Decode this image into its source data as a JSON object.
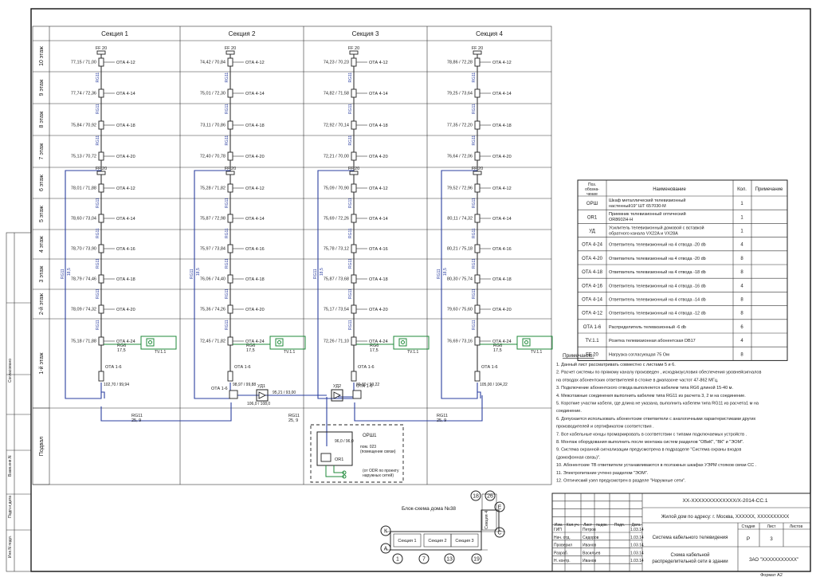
{
  "sections": [
    "Секция 1",
    "Секция 2",
    "Секция 3",
    "Секция 4"
  ],
  "floors": [
    "10 этаж",
    "9 этаж",
    "8 этаж",
    "7 этаж",
    "6 этаж",
    "5 этаж",
    "4 этаж",
    "3 этаж",
    "2-й этаж",
    "1-й этаж"
  ],
  "basement": "Подвал",
  "levels": [
    [
      "77,15 / 71,00",
      "77,74 / 72,36",
      "75,84 / 70,92",
      "75,13 / 70,72",
      "78,01 / 71,88",
      "78,60 / 73,04",
      "78,70 / 73,90",
      "78,79 / 74,46",
      "78,09 / 74,32",
      "75,18 / 71,88"
    ],
    [
      "74,42 / 70,84",
      "75,01 / 72,30",
      "73,11 / 70,86",
      "72,40 / 70,78",
      "75,28 / 71,82",
      "75,87 / 72,98",
      "75,97 / 73,84",
      "76,06 / 74,40",
      "75,36 / 74,26",
      "72,45 / 71,82"
    ],
    [
      "74,23 / 70,23",
      "74,82 / 71,58",
      "72,92 / 70,14",
      "72,21 / 70,00",
      "75,09 / 70,90",
      "75,69 / 72,26",
      "75,78 / 73,12",
      "75,87 / 73,68",
      "75,17 / 73,54",
      "72,26 / 71,10"
    ],
    [
      "78,86 / 72,28",
      "79,25 / 73,64",
      "77,35 / 72,20",
      "76,64 / 72,06",
      "79,52 / 72,96",
      "80,11 / 74,32",
      "80,21 / 75,18",
      "80,30 / 75,74",
      "79,60 / 75,60",
      "76,69 / 73,16"
    ]
  ],
  "taps": [
    "ОТА 4-12",
    "ОТА 4-14",
    "ОТА 4-18",
    "ОТА 4-20",
    "ОТА 4-12",
    "ОТА 4-14",
    "ОТА 4-16",
    "ОТА 4-18",
    "ОТА 4-20",
    "ОТА 4-24"
  ],
  "ff20": "FF 20",
  "rg11": "RG11",
  "rg11_num": "18,5",
  "rg6": "RG6",
  "rg6_num": "17,5",
  "outlet": "TV.1.1",
  "ota16": "ОТА 1-6",
  "basement_levels": [
    "102,70 / 99,94",
    "98,97 / 99,88",
    "89,80 / 99,22",
    "105,00 / 104,22"
  ],
  "ud1": "УД1",
  "ud1_in": "95,21 / 93,00",
  "ud1_out": "106,0 / 108,0",
  "ud2": "УД2",
  "trunk_labels": [
    {
      "a": "RG11",
      "b": "25, 9"
    },
    {
      "a": "RG11",
      "b": "25, 9"
    },
    {
      "a": "RG11",
      "b": "25, 9"
    }
  ],
  "orsh": "ОРШ1",
  "orsh_level": "96,0 / 96,0",
  "orsh_room": [
    "пом. 023",
    "(помещение связи)"
  ],
  "or1": "OR1",
  "odr_note": [
    "(от ODR по проекту",
    "наружных сетей)"
  ],
  "spec": {
    "headers": [
      "Поз. обозна-чение",
      "Наименование",
      "Кол.",
      "Примечание"
    ],
    "rows": [
      {
        "pos": "ОРШ",
        "name": [
          "Шкаф металлический телевизионный",
          "настенный19\" ШТ 657030-М"
        ],
        "qty": "1"
      },
      {
        "pos": "OR1",
        "name": [
          "Приемник телевизионный оптический",
          "OR8602H-H"
        ],
        "qty": "1"
      },
      {
        "pos": "УД",
        "name": [
          "Усилитель телевизионный домовой с вставкой",
          "обратного канала VX22A и VX28A"
        ],
        "qty": "1"
      },
      {
        "pos": "ОТА 4-24",
        "name": [
          "Ответвитель телевизионный на 4 отвода -20 db"
        ],
        "qty": "4"
      },
      {
        "pos": "ОТА 4-20",
        "name": [
          "Ответвитель телевизионный на 4 отвода -20 db"
        ],
        "qty": "8"
      },
      {
        "pos": "ОТА 4-18",
        "name": [
          "Ответвитель телевизионный на 4 отвода -18 db"
        ],
        "qty": "8"
      },
      {
        "pos": "ОТА 4-16",
        "name": [
          "Ответвитель телевизионный на 4 отвода -16 db"
        ],
        "qty": "4"
      },
      {
        "pos": "ОТА 4-14",
        "name": [
          "Ответвитель телевизионный на 4 отвода -14 db"
        ],
        "qty": "8"
      },
      {
        "pos": "ОТА 4-12",
        "name": [
          "Ответвитель телевизионный на 4 отвода -12 db"
        ],
        "qty": "8"
      },
      {
        "pos": "ОТА 1-6",
        "name": [
          "Распределитель телевизионный -6 db"
        ],
        "qty": "6"
      },
      {
        "pos": "TV.1.1",
        "name": [
          "Розетка телевизионная абонентская DB17"
        ],
        "qty": "4"
      },
      {
        "pos": "FF 20",
        "name": [
          "Нагрузка согласующая 75 Ом"
        ],
        "qty": "8"
      }
    ]
  },
  "notes_title": "Примечание:",
  "notes": [
    "1. Данный лист рассматривать совместно с листами    5 и 6.",
    "2. Расчет системы по прямому каналу произведен , исходяизусловия обеспечения уровнейсигналов",
    "  на отводах абонентских ответвителей в стояке в диапазоне частот  47-862 МГц.",
    "3. Подключение абонентского отвода выполняется кабелем типа  RG6 длиной 15-40 м.",
    "4. Межэтажные соединения выполнить кабелем типа  RG11 из расчета 3, 2 м на соединение.",
    "5. Короткие участки кабеля, где длина не указана, выполнить кабелем типа RG11 из расчета1 м на",
    "соединение.",
    "6. Допускается использовать абонентские ответвители с аналогичными характеристиками других",
    "производителей и сертификатом  соответствия .",
    "7. Все кабельные концы промаркировать в соответствии с типами подключаемых устройств .",
    "8. Монтаж оборудования выполнить после монтажа систем разделов  \"ОВиК\", \"ВК\" и \"ЭОМ\".",
    "9. Система охранной сигнализации предусмотрена в подразделе   \"Система охраны входов",
    "  (домофонная связь)\".",
    "10. Абонентские ТВ ответвители устанавливаются в поэтажных шкафах УЭРМ стояков связи СС .",
    "11. Электропитание учтено разделом  \"ЭОМ\".",
    "12. Оптический узел предусмотрен в разделе  \"Наружные сети\"."
  ],
  "block_scheme": {
    "title": "Блок-схема дома №38",
    "sections": [
      "Секция 1",
      "Секция 2",
      "Секция 3",
      "Секция 4"
    ],
    "axes": [
      "К",
      "А",
      "1",
      "7",
      "13",
      "19",
      "18",
      "26",
      "Е",
      "С"
    ]
  },
  "title_block": {
    "code": "XX-XXXXXXXXXXXXX/X-2014-СС.1",
    "address": "Жилой дом по адресу: г. Москва, XXXXXX,  XXXXXXXXXX",
    "system": "Система кабельного телевидения",
    "sheet_name": [
      "Схема кабельной",
      "распределительной сети в здании"
    ],
    "company": "ЗАО \"XXXXXXXXXXX\"",
    "stage_hdr": "Стадия",
    "sheet_hdr": "Лист",
    "sheets_hdr": "Листов",
    "stage": "Р",
    "sheet": "3",
    "cols": [
      "Изм.",
      "Кол.уч.",
      "Лист",
      "№док.",
      "Подп.",
      "Дата"
    ],
    "people": [
      {
        "role": "ГИП",
        "name": "Петров",
        "date": "1.03.14"
      },
      {
        "role": "Нач. отд.",
        "name": "Сидоров",
        "date": "1.03.14"
      },
      {
        "role": "Проверил",
        "name": "Иванов",
        "date": "1.03.14"
      },
      {
        "role": "Разраб.",
        "name": "Васильев",
        "date": "1.03.14"
      },
      {
        "role": "Н. контр.",
        "name": "Иванов",
        "date": "1.03.14"
      }
    ],
    "format": "Формат А2"
  },
  "side_labels": [
    "Согласовано",
    "Взам.инв.N",
    "Подп.и дата",
    "Инв.N подл."
  ],
  "colors": {
    "riser": "#2b3fa0",
    "outlet": "#1f8a3a",
    "line": "#222222"
  }
}
